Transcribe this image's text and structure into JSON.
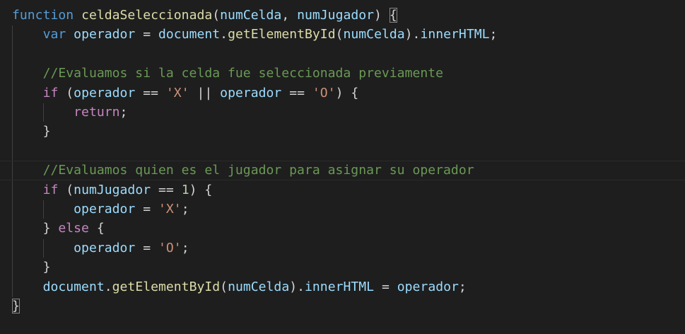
{
  "editor": {
    "theme_colors": {
      "background": "#1e1e1e",
      "keyword": "#569cd6",
      "control": "#c586c0",
      "function": "#dcdcaa",
      "variable": "#9cdcfe",
      "string": "#ce9178",
      "number": "#b5cea8",
      "comment": "#6a9955"
    },
    "lines": [
      [
        {
          "t": "function",
          "c": "kw-blue"
        },
        {
          "t": " ",
          "c": "punc"
        },
        {
          "t": "celdaSeleccionada",
          "c": "fn"
        },
        {
          "t": "(",
          "c": "punc"
        },
        {
          "t": "numCelda",
          "c": "var"
        },
        {
          "t": ", ",
          "c": "punc"
        },
        {
          "t": "numJugador",
          "c": "var"
        },
        {
          "t": ") ",
          "c": "punc"
        },
        {
          "t": "{",
          "c": "punc brace-match"
        }
      ],
      [
        {
          "t": "    ",
          "c": "punc"
        },
        {
          "t": "var",
          "c": "kw-blue"
        },
        {
          "t": " ",
          "c": "punc"
        },
        {
          "t": "operador",
          "c": "var"
        },
        {
          "t": " = ",
          "c": "punc"
        },
        {
          "t": "document",
          "c": "var"
        },
        {
          "t": ".",
          "c": "punc"
        },
        {
          "t": "getElementById",
          "c": "fn"
        },
        {
          "t": "(",
          "c": "punc"
        },
        {
          "t": "numCelda",
          "c": "var"
        },
        {
          "t": ").",
          "c": "punc"
        },
        {
          "t": "innerHTML",
          "c": "var"
        },
        {
          "t": ";",
          "c": "punc"
        }
      ],
      [],
      [
        {
          "t": "    ",
          "c": "punc"
        },
        {
          "t": "//Evaluamos si la celda fue seleccionada previamente",
          "c": "cmt"
        }
      ],
      [
        {
          "t": "    ",
          "c": "punc"
        },
        {
          "t": "if",
          "c": "kw-purple"
        },
        {
          "t": " (",
          "c": "punc"
        },
        {
          "t": "operador",
          "c": "var"
        },
        {
          "t": " == ",
          "c": "punc"
        },
        {
          "t": "'X'",
          "c": "str"
        },
        {
          "t": " || ",
          "c": "punc"
        },
        {
          "t": "operador",
          "c": "var"
        },
        {
          "t": " == ",
          "c": "punc"
        },
        {
          "t": "'O'",
          "c": "str"
        },
        {
          "t": ") {",
          "c": "punc"
        }
      ],
      [
        {
          "t": "        ",
          "c": "punc"
        },
        {
          "t": "return",
          "c": "kw-purple"
        },
        {
          "t": ";",
          "c": "punc"
        }
      ],
      [
        {
          "t": "    }",
          "c": "punc"
        }
      ],
      [],
      [
        {
          "t": "    ",
          "c": "punc"
        },
        {
          "t": "//Evaluamos quien es el jugador para asignar su operador",
          "c": "cmt"
        }
      ],
      [
        {
          "t": "    ",
          "c": "punc"
        },
        {
          "t": "if",
          "c": "kw-purple"
        },
        {
          "t": " (",
          "c": "punc"
        },
        {
          "t": "numJugador",
          "c": "var"
        },
        {
          "t": " == ",
          "c": "punc"
        },
        {
          "t": "1",
          "c": "num"
        },
        {
          "t": ") {",
          "c": "punc"
        }
      ],
      [
        {
          "t": "        ",
          "c": "punc"
        },
        {
          "t": "operador",
          "c": "var"
        },
        {
          "t": " = ",
          "c": "punc"
        },
        {
          "t": "'X'",
          "c": "str"
        },
        {
          "t": ";",
          "c": "punc"
        }
      ],
      [
        {
          "t": "    } ",
          "c": "punc"
        },
        {
          "t": "else",
          "c": "kw-purple"
        },
        {
          "t": " {",
          "c": "punc"
        }
      ],
      [
        {
          "t": "        ",
          "c": "punc"
        },
        {
          "t": "operador",
          "c": "var"
        },
        {
          "t": " = ",
          "c": "punc"
        },
        {
          "t": "'O'",
          "c": "str"
        },
        {
          "t": ";",
          "c": "punc"
        }
      ],
      [
        {
          "t": "    }",
          "c": "punc"
        }
      ],
      [
        {
          "t": "    ",
          "c": "punc"
        },
        {
          "t": "document",
          "c": "var"
        },
        {
          "t": ".",
          "c": "punc"
        },
        {
          "t": "getElementById",
          "c": "fn"
        },
        {
          "t": "(",
          "c": "punc"
        },
        {
          "t": "numCelda",
          "c": "var"
        },
        {
          "t": ").",
          "c": "punc"
        },
        {
          "t": "innerHTML",
          "c": "var"
        },
        {
          "t": " = ",
          "c": "punc"
        },
        {
          "t": "operador",
          "c": "var"
        },
        {
          "t": ";",
          "c": "punc"
        }
      ],
      [
        {
          "t": "}",
          "c": "punc brace-match"
        }
      ]
    ]
  }
}
